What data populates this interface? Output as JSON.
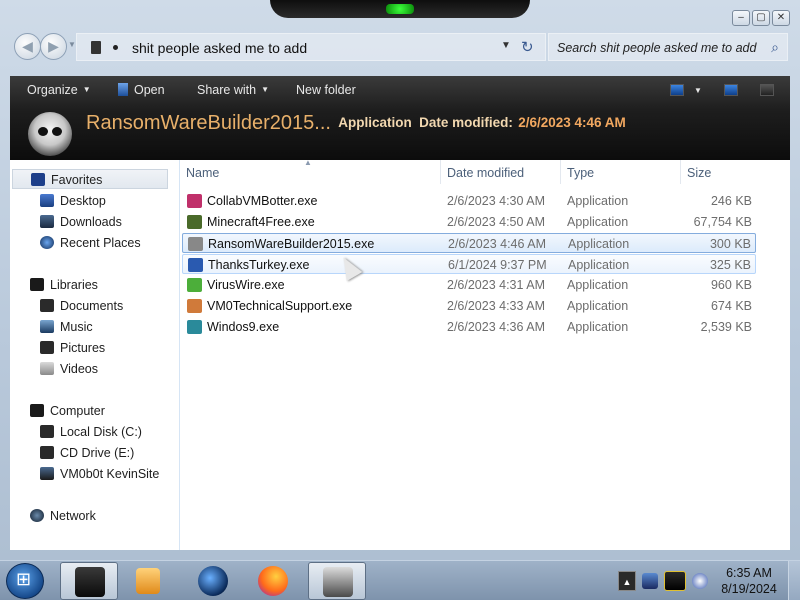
{
  "window": {
    "controls": [
      "‒",
      "▢",
      "✕"
    ]
  },
  "address_bar": {
    "path": "shit people asked me to add",
    "search_placeholder": "Search shit people asked me to add"
  },
  "toolbar": {
    "organize": "Organize",
    "open": "Open",
    "share_with": "Share with",
    "new_folder": "New folder"
  },
  "details": {
    "name": "RansomWareBuilder2015...",
    "type": "Application",
    "modified_label": "Date modified:",
    "modified_value": "2/6/2023 4:46 AM"
  },
  "nav": {
    "favorites": "Favorites",
    "desktop": "Desktop",
    "downloads": "Downloads",
    "recent": "Recent Places",
    "libraries": "Libraries",
    "documents": "Documents",
    "music": "Music",
    "pictures": "Pictures",
    "videos": "Videos",
    "computer": "Computer",
    "local_disk": "Local Disk (C:)",
    "cd_drive": "CD Drive (E:)",
    "network_share": "VM0b0t KevinSite",
    "network": "Network"
  },
  "columns": {
    "name": "Name",
    "date": "Date modified",
    "type": "Type",
    "size": "Size"
  },
  "files": [
    {
      "name": "CollabVMBotter.exe",
      "date": "2/6/2023 4:30 AM",
      "type": "Application",
      "size": "246 KB",
      "color": "#c0306a"
    },
    {
      "name": "Minecraft4Free.exe",
      "date": "2/6/2023 4:50 AM",
      "type": "Application",
      "size": "67,754 KB",
      "color": "#4a6a2a"
    },
    {
      "name": "RansomWareBuilder2015.exe",
      "date": "2/6/2023 4:46 AM",
      "type": "Application",
      "size": "300 KB",
      "color": "#888888"
    },
    {
      "name": "ThanksTurkey.exe",
      "date": "6/1/2024 9:37 PM",
      "type": "Application",
      "size": "325 KB",
      "color": "#2a5ab0"
    },
    {
      "name": "VirusWire.exe",
      "date": "2/6/2023 4:31 AM",
      "type": "Application",
      "size": "960 KB",
      "color": "#4cae3a"
    },
    {
      "name": "VM0TechnicalSupport.exe",
      "date": "2/6/2023 4:33 AM",
      "type": "Application",
      "size": "674 KB",
      "color": "#d07a3a"
    },
    {
      "name": "Windos9.exe",
      "date": "2/6/2023 4:36 AM",
      "type": "Application",
      "size": "2,539 KB",
      "color": "#2a8a9a"
    }
  ],
  "taskbar": {
    "tray_arrow": "▲",
    "time": "6:35 AM",
    "date": "8/19/2024"
  }
}
